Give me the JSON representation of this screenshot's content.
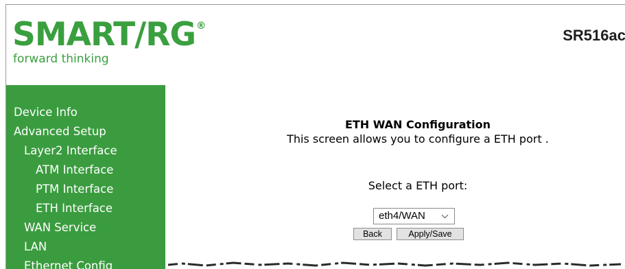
{
  "header": {
    "brand": "SMART/RG",
    "registered": "®",
    "tagline": "forward thinking",
    "model": "SR516ac"
  },
  "sidebar": {
    "items": [
      {
        "label": "Device Info",
        "level": 0
      },
      {
        "label": "Advanced Setup",
        "level": 0
      },
      {
        "label": "Layer2 Interface",
        "level": 1
      },
      {
        "label": "ATM Interface",
        "level": 2
      },
      {
        "label": "PTM Interface",
        "level": 2
      },
      {
        "label": "ETH Interface",
        "level": 2
      },
      {
        "label": "WAN Service",
        "level": 1
      },
      {
        "label": "LAN",
        "level": 1
      },
      {
        "label": "Ethernet Config",
        "level": 1
      }
    ]
  },
  "main": {
    "title": "ETH WAN Configuration",
    "description": "This screen allows you to configure a ETH port .",
    "select_label": "Select a ETH port:",
    "selected_port": "eth4/WAN",
    "back_label": "Back",
    "apply_label": "Apply/Save"
  },
  "colors": {
    "brand_green": "#3a9f3f",
    "sidebar_green": "#3a9c3f"
  }
}
